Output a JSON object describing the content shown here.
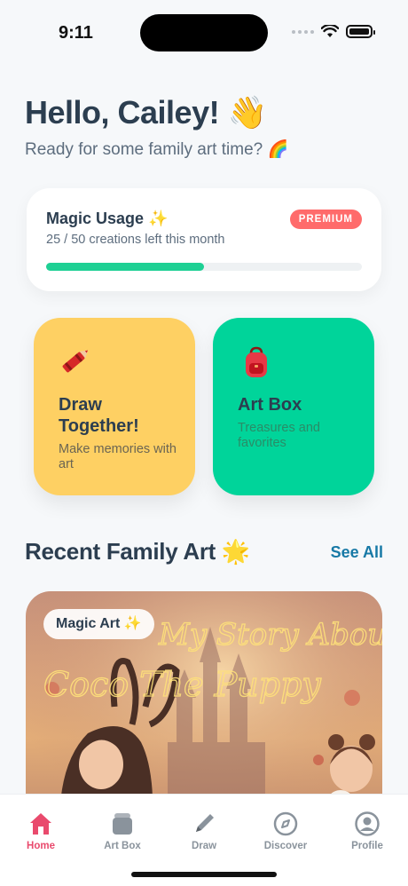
{
  "status_bar": {
    "time": "9:11"
  },
  "greeting": {
    "title": "Hello, Cailey! 👋",
    "subtitle": "Ready for some family art time? 🌈"
  },
  "usage": {
    "title": "Magic Usage ✨",
    "subtitle": "25 / 50 creations left this month",
    "badge": "PREMIUM",
    "progress_fraction": 0.5
  },
  "features": [
    {
      "title": "Draw Together!",
      "description": "Make memories with art",
      "icon": "crayon-icon"
    },
    {
      "title": "Art Box",
      "description": "Treasures and favorites",
      "icon": "backpack-icon"
    }
  ],
  "recent": {
    "title": "Recent Family Art 🌟",
    "see_all_label": "See All",
    "art_badge": "Magic Art ✨",
    "art_text_line1": "My Story About",
    "art_text_line2": "Coco The Puppy"
  },
  "tabs": [
    {
      "label": "Home",
      "icon": "home-icon",
      "active": true
    },
    {
      "label": "Art Box",
      "icon": "box-icon",
      "active": false
    },
    {
      "label": "Draw",
      "icon": "pencil-icon",
      "active": false
    },
    {
      "label": "Discover",
      "icon": "compass-icon",
      "active": false
    },
    {
      "label": "Profile",
      "icon": "profile-icon",
      "active": false
    }
  ],
  "colors": {
    "accent_pink": "#e94a6d",
    "premium_red": "#ff6b6b",
    "progress_green": "#1ed094",
    "draw_card_yellow": "#fed063",
    "artbox_card_green": "#00d49a",
    "link_blue": "#1779a6"
  }
}
